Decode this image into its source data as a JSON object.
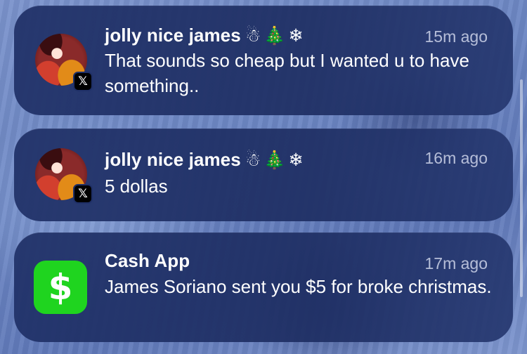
{
  "notifications": [
    {
      "app": "X",
      "app_icon": "x-logo-icon",
      "sender": "jolly nice james",
      "sender_emoji": "☃🎄❄",
      "time": "15m ago",
      "message": "That sounds so cheap but I wanted u to have something..",
      "badge_glyph": "𝕏"
    },
    {
      "app": "X",
      "app_icon": "x-logo-icon",
      "sender": "jolly nice james",
      "sender_emoji": "☃🎄❄",
      "time": "16m ago",
      "message": "5 dollas",
      "badge_glyph": "𝕏"
    },
    {
      "app": "Cash App",
      "app_icon": "cashapp-icon",
      "app_glyph": "$",
      "sender": "Cash App",
      "time": "17m ago",
      "message": "James Soriano sent you $5 for broke christmas.",
      "accent_color": "#1fd41f"
    }
  ],
  "colors": {
    "card_background": "#203168",
    "text_primary": "#ffffff",
    "text_secondary": "#c8d0ea"
  }
}
